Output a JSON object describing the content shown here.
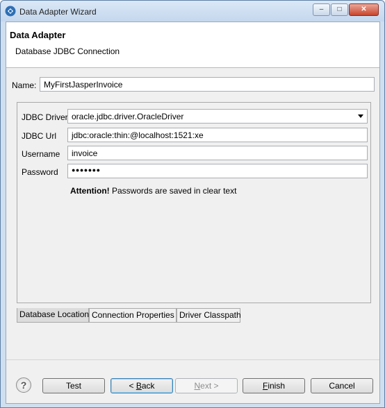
{
  "window": {
    "title": "Data Adapter Wizard",
    "minimize": "–",
    "maximize": "□",
    "close": "✕"
  },
  "header": {
    "title": "Data Adapter",
    "subtitle": "Database JDBC Connection"
  },
  "name": {
    "label": "Name:",
    "value": "MyFirstJasperInvoice"
  },
  "connection": {
    "driver_label": "JDBC Driver",
    "driver_value": "oracle.jdbc.driver.OracleDriver",
    "url_label": "JDBC Url",
    "url_value": "jdbc:oracle:thin:@localhost:1521:xe",
    "username_label": "Username",
    "username_value": "invoice",
    "password_label": "Password",
    "password_value": "●●●●●●●",
    "attention_bold": "Attention!",
    "attention_text": "Passwords are saved in clear text"
  },
  "tabs": [
    {
      "label": "Database Location",
      "active": true
    },
    {
      "label": "Connection Properties",
      "active": false
    },
    {
      "label": "Driver Classpath",
      "active": false
    }
  ],
  "buttons": {
    "help": "?",
    "test": "Test",
    "back_prefix": "< ",
    "back_mnemonic": "B",
    "back_rest": "ack",
    "next_mnemonic": "N",
    "next_rest": "ext >",
    "finish_mnemonic": "F",
    "finish_rest": "inish",
    "cancel": "Cancel"
  },
  "colors": {
    "accent": "#3c7fb1",
    "window_frame": "#cfdff0",
    "close_button": "#c9452c"
  },
  "icons": [
    "jaspersoft-app-icon",
    "help-icon",
    "dropdown-arrow-icon"
  ]
}
